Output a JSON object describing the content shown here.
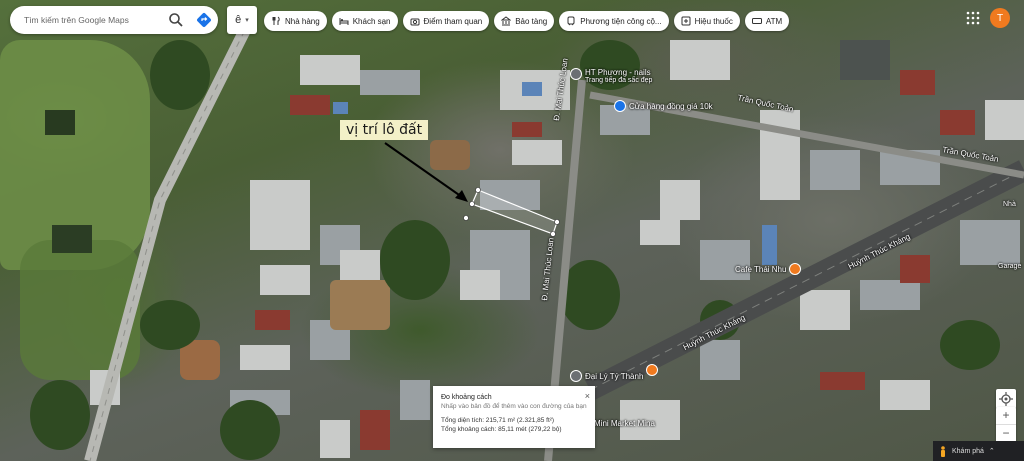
{
  "search": {
    "placeholder": "Tìm kiếm trên Google Maps"
  },
  "menu": {
    "label": "ê"
  },
  "chips": [
    {
      "icon": "restaurant-icon",
      "label": "Nhà hàng"
    },
    {
      "icon": "hotel-icon",
      "label": "Khách sạn"
    },
    {
      "icon": "camera-icon",
      "label": "Điểm tham quan"
    },
    {
      "icon": "museum-icon",
      "label": "Bảo tàng"
    },
    {
      "icon": "transit-icon",
      "label": "Phương tiện công cộ..."
    },
    {
      "icon": "pharmacy-icon",
      "label": "Hiệu thuốc"
    },
    {
      "icon": "atm-icon",
      "label": "ATM"
    }
  ],
  "avatar": {
    "letter": "T",
    "color": "#f07a1f"
  },
  "annotation": {
    "text": "vị trí lô đất"
  },
  "roads": {
    "tran_quoc_toan_1": "Trần Quốc Toản",
    "tran_quoc_toan_2": "Trần Quốc Toản",
    "huynh_thuc_khang_1": "Huỳnh Thúc Kháng",
    "huynh_thuc_khang_2": "Huỳnh Thúc Kháng",
    "mai_thuc_loan_1": "Đ. Mai Thúc Loan",
    "mai_thuc_loan_2": "Đ. Mai Thúc Loan",
    "nha_right": "Nhà",
    "garage_right": "Garage"
  },
  "places": {
    "ht_phuong_line1": "HT Phương - nails",
    "ht_phuong_line2": "Trang tiếp đa sấc đẹp",
    "cua_hang": "Cửa hàng đồng giá 10k",
    "cafe": "Cafe Thái Nhu",
    "dai_ly": "Đại Lý Tý Thành",
    "mini_market": "Mini Market Mina"
  },
  "measure": {
    "title": "Đo khoảng cách",
    "hint": "Nhấp vào bản đồ để thêm vào con đường của bạn",
    "area": "Tổng diện tích: 215,71 m² (2.321,85 ft²)",
    "distance": "Tổng khoảng cách: 85,11 mét (279,22 bộ)",
    "close": "×"
  },
  "controls": {
    "zoom_in": "+",
    "zoom_out": "−"
  },
  "bottom": {
    "explore": "Khám phá",
    "chevron": "⌃"
  },
  "colors": {
    "accent_blue": "#1a73e8",
    "label_bg": "#f3f0c8",
    "poi_orange": "#f07a1f",
    "poi_gray": "#6b6f73"
  }
}
